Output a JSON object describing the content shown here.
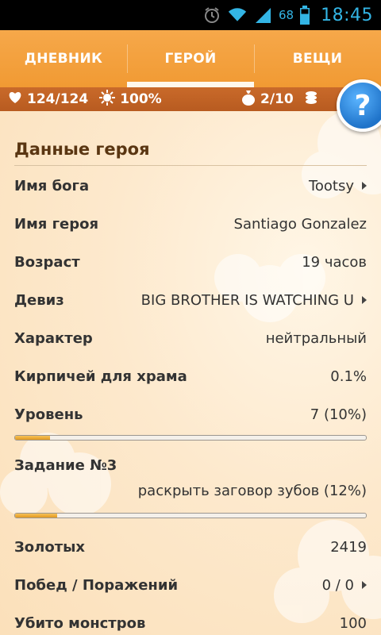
{
  "status_bar": {
    "battery_level": "68",
    "time": "18:45",
    "icons": [
      "alarm-icon",
      "wifi-icon",
      "signal-icon",
      "battery-icon"
    ]
  },
  "tabs": [
    {
      "label": "ДНЕВНИК",
      "active": false
    },
    {
      "label": "ГЕРОЙ",
      "active": true
    },
    {
      "label": "ВЕЩИ",
      "active": false
    }
  ],
  "stats": {
    "health": "124/124",
    "godpower": "100%",
    "inventory": "2/10"
  },
  "help_label": "?",
  "hero": {
    "section_title": "Данные героя",
    "god_name": {
      "label": "Имя бога",
      "value": "Tootsy"
    },
    "hero_name": {
      "label": "Имя героя",
      "value": "Santiago Gonzalez"
    },
    "age": {
      "label": "Возраст",
      "value": "19 часов"
    },
    "motto": {
      "label": "Девиз",
      "value": "BIG BROTHER IS WATCHING U"
    },
    "character": {
      "label": "Характер",
      "value": "нейтральный"
    },
    "bricks": {
      "label": "Кирпичей для храма",
      "value": "0.1%"
    },
    "level": {
      "label": "Уровень",
      "value": "7 (10%)",
      "progress": 0.1
    },
    "quest": {
      "label": "Задание №3",
      "value": "раскрыть заговор зубов (12%)",
      "progress": 0.12
    },
    "gold": {
      "label": "Золотых",
      "value": "2419"
    },
    "wins": {
      "label": "Побед / Поражений",
      "value": "0 / 0"
    },
    "monsters": {
      "label": "Убито монстров",
      "value": "100"
    }
  },
  "colors": {
    "accent": "#f19a33",
    "stats_bar": "#b85b20",
    "help_button": "#1f73c9",
    "status_blue": "#33b5e5"
  }
}
